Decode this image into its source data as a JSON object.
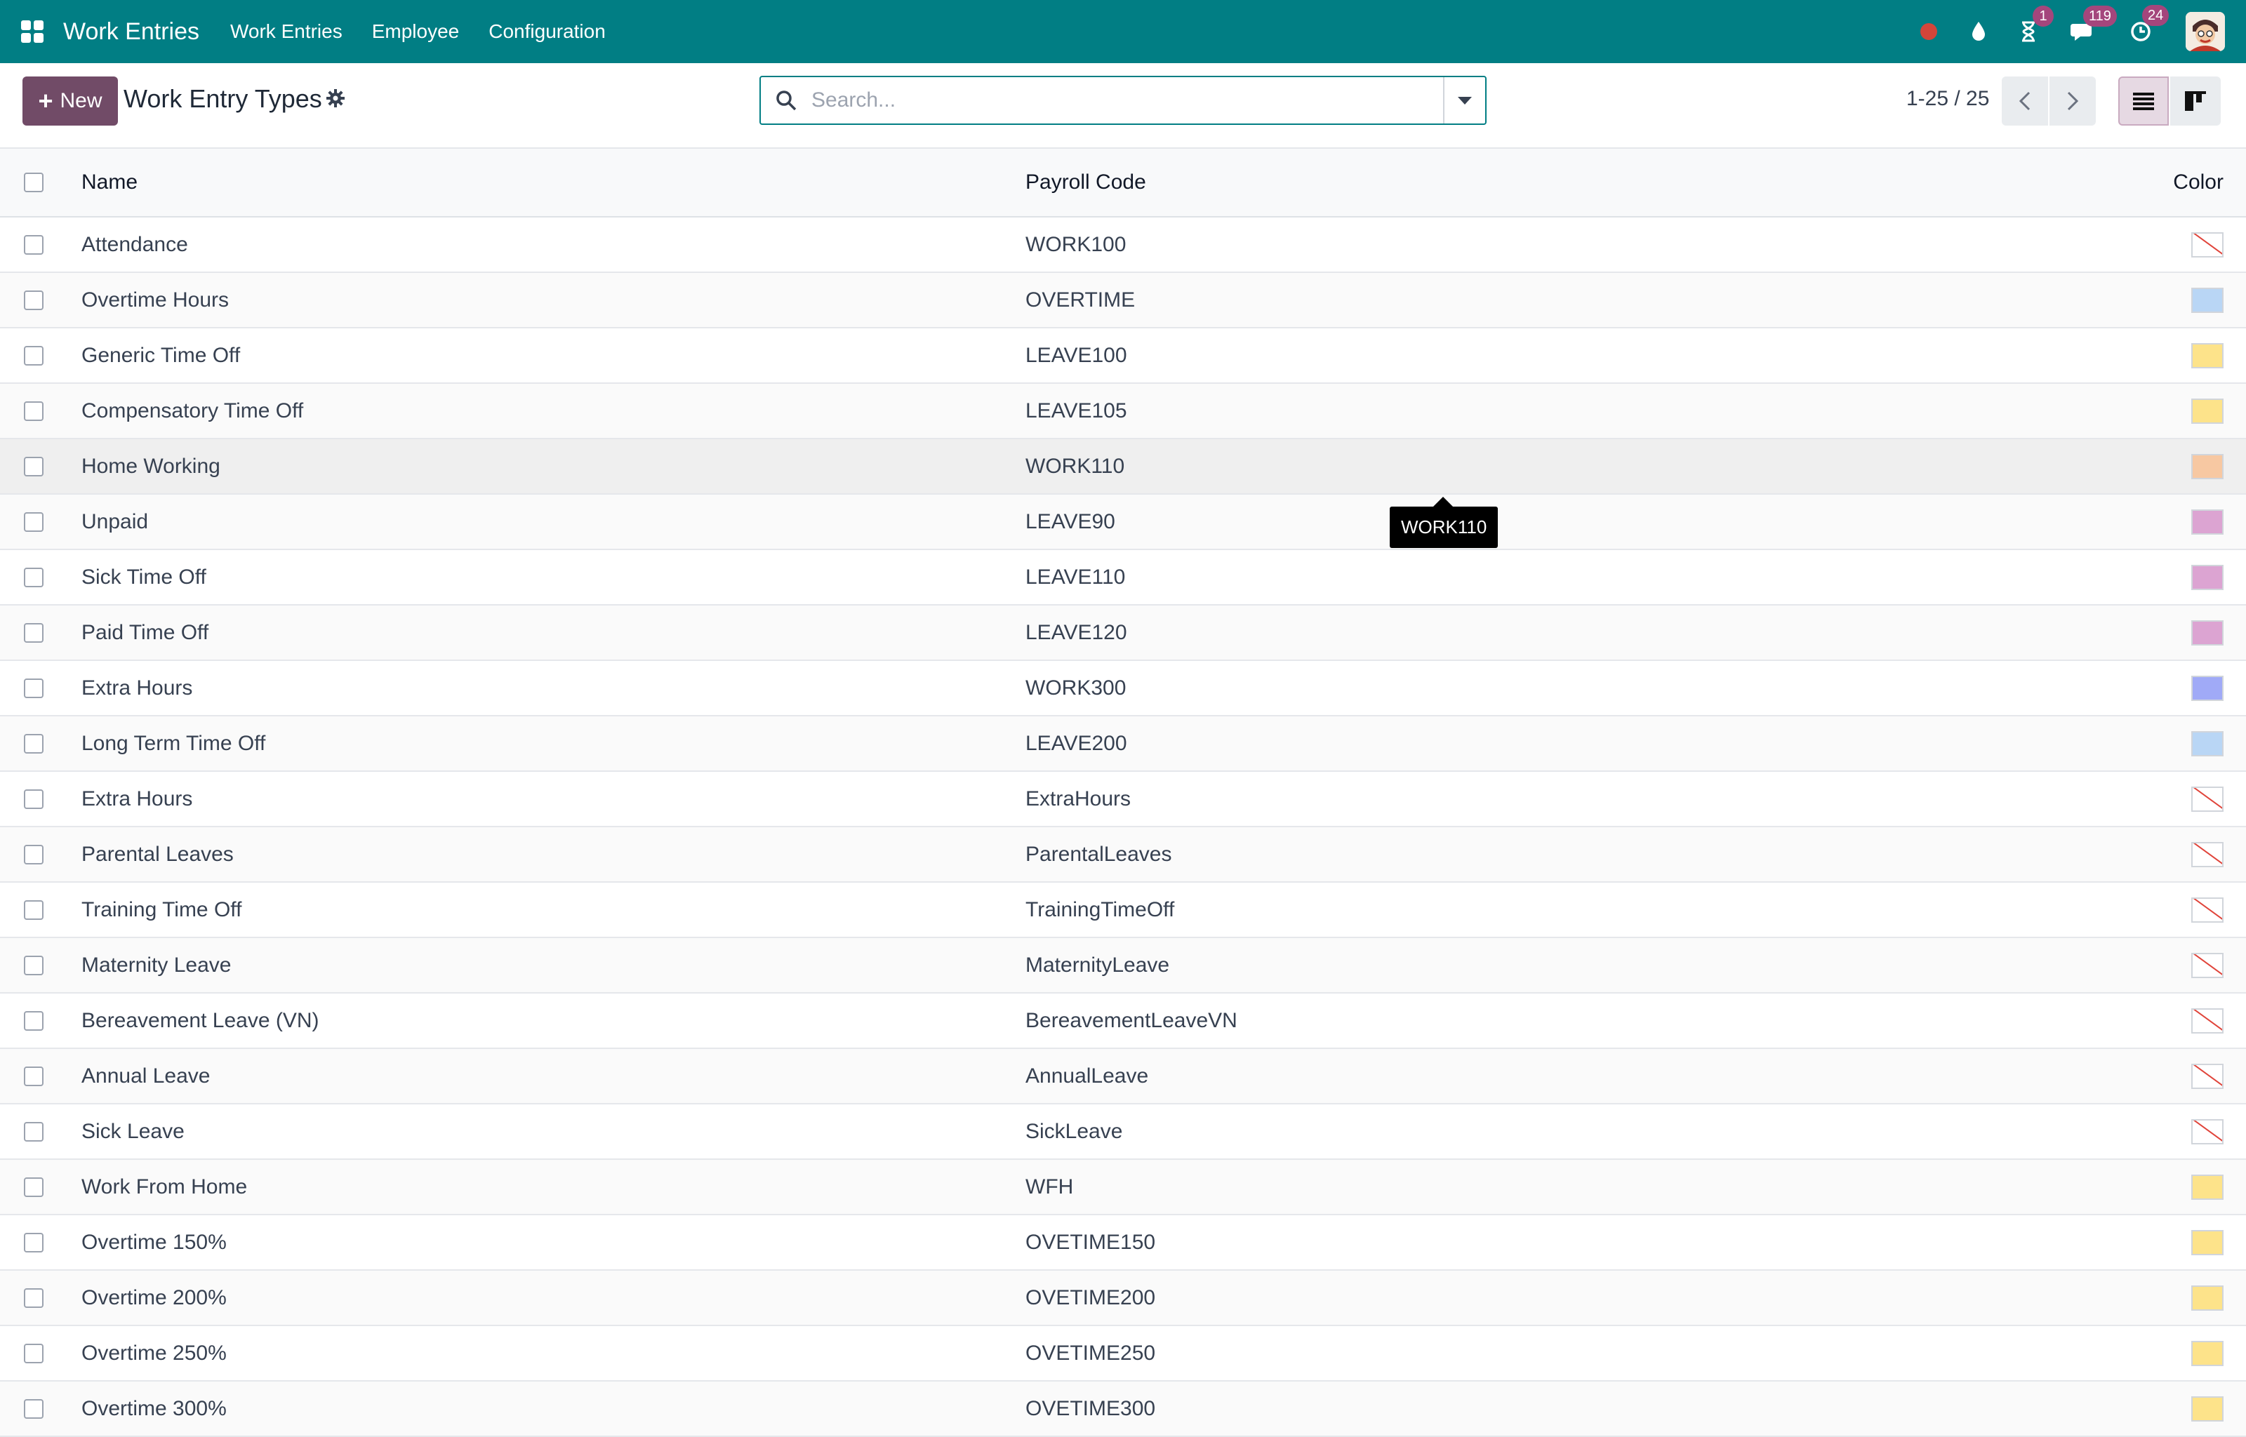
{
  "navbar": {
    "brand": "Work Entries",
    "menus": [
      "Work Entries",
      "Employee",
      "Configuration"
    ],
    "badges": {
      "activities": "1",
      "messages": "119",
      "updates": "24"
    }
  },
  "control": {
    "new_label": "New",
    "title": "Work Entry Types",
    "search_placeholder": "Search...",
    "pager": "1-25 / 25"
  },
  "table": {
    "headers": {
      "name": "Name",
      "code": "Payroll Code",
      "color": "Color"
    },
    "rows": [
      {
        "name": "Attendance",
        "code": "WORK100",
        "color": "none"
      },
      {
        "name": "Overtime Hours",
        "code": "OVERTIME",
        "color": "#b9d6f5"
      },
      {
        "name": "Generic Time Off",
        "code": "LEAVE100",
        "color": "#fde38a"
      },
      {
        "name": "Compensatory Time Off",
        "code": "LEAVE105",
        "color": "#fde38a"
      },
      {
        "name": "Home Working",
        "code": "WORK110",
        "color": "#f7c8a2"
      },
      {
        "name": "Unpaid",
        "code": "LEAVE90",
        "color": "#dca4d2"
      },
      {
        "name": "Sick Time Off",
        "code": "LEAVE110",
        "color": "#dca4d2"
      },
      {
        "name": "Paid Time Off",
        "code": "LEAVE120",
        "color": "#dca4d2"
      },
      {
        "name": "Extra Hours",
        "code": "WORK300",
        "color": "#a0aaf7"
      },
      {
        "name": "Long Term Time Off",
        "code": "LEAVE200",
        "color": "#b9d6f5"
      },
      {
        "name": "Extra Hours",
        "code": "ExtraHours",
        "color": "none"
      },
      {
        "name": "Parental Leaves",
        "code": "ParentalLeaves",
        "color": "none"
      },
      {
        "name": "Training Time Off",
        "code": "TrainingTimeOff",
        "color": "none"
      },
      {
        "name": "Maternity Leave",
        "code": "MaternityLeave",
        "color": "none"
      },
      {
        "name": "Bereavement Leave (VN)",
        "code": "BereavementLeaveVN",
        "color": "none"
      },
      {
        "name": "Annual Leave",
        "code": "AnnualLeave",
        "color": "none"
      },
      {
        "name": "Sick Leave",
        "code": "SickLeave",
        "color": "none"
      },
      {
        "name": "Work From Home",
        "code": "WFH",
        "color": "#fde38a"
      },
      {
        "name": "Overtime 150%",
        "code": "OVETIME150",
        "color": "#fde38a"
      },
      {
        "name": "Overtime 200%",
        "code": "OVETIME200",
        "color": "#fde38a"
      },
      {
        "name": "Overtime 250%",
        "code": "OVETIME250",
        "color": "#fde38a"
      },
      {
        "name": "Overtime 300%",
        "code": "OVETIME300",
        "color": "#fde38a"
      }
    ]
  },
  "tooltip": "WORK110",
  "theme": {
    "navbar": "#017e84",
    "primary": "#714b67",
    "no_color_line": "#e0443a"
  }
}
